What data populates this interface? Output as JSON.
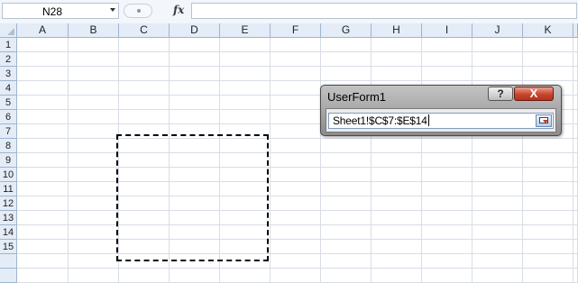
{
  "formula_bar": {
    "name_box": "N28",
    "fx": "fx",
    "formula": ""
  },
  "columns": [
    "A",
    "B",
    "C",
    "D",
    "E",
    "F",
    "G",
    "H",
    "I",
    "J",
    "K"
  ],
  "rows": [
    "1",
    "2",
    "3",
    "4",
    "5",
    "6",
    "7",
    "8",
    "9",
    "10",
    "11",
    "12",
    "13",
    "14",
    "15"
  ],
  "userform": {
    "title": "UserForm1",
    "help_label": "?",
    "close_label": "X",
    "refedit_value": "Sheet1!$C$7:$E$14"
  },
  "colors": {
    "header_bg": "#e4ecf7",
    "gridline": "#d8dde6",
    "close_red": "#c6452d"
  }
}
